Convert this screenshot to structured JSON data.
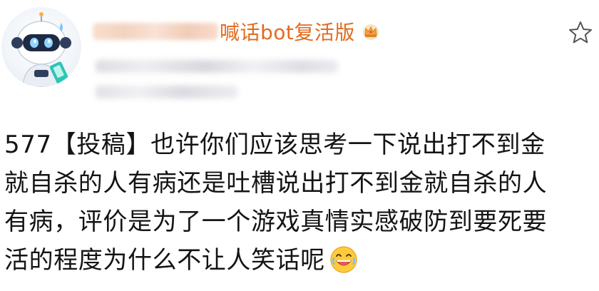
{
  "header": {
    "name_suffix": "喊话bot复活版",
    "crown_icon": "crown-icon",
    "star_icon": "star-icon"
  },
  "post": {
    "lines": [
      "577【投稿】也许你们应该思考一下说出打不到金",
      "就自杀的人有病还是吐槽说出打不到金就自杀的人",
      "有病，评价是为了一个游戏真情实感破防到要死要",
      "活的程度为什么不让人笑话呢"
    ],
    "trailing_emoji": "laughing-emoji"
  },
  "colors": {
    "name_color": "#e46a1c",
    "text_color": "#141414"
  }
}
